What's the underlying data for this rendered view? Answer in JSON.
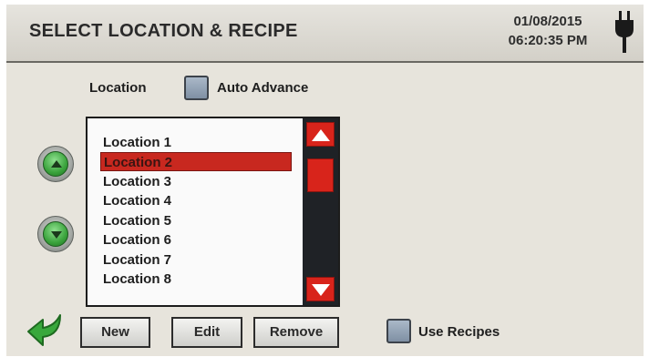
{
  "header": {
    "title": "SELECT LOCATION & RECIPE",
    "date": "01/08/2015",
    "time": "06:20:35 PM",
    "power_icon": "plug-icon"
  },
  "location_label": "Location",
  "auto_advance": {
    "label": "Auto Advance",
    "checked": false
  },
  "location_list": {
    "items": [
      "Location 1",
      "Location 2",
      "Location 3",
      "Location 4",
      "Location 5",
      "Location 6",
      "Location 7",
      "Location 8"
    ],
    "selected_index": 1
  },
  "nav": {
    "up_icon": "up-arrow-icon",
    "down_icon": "down-arrow-icon",
    "back_icon": "back-arrow-icon"
  },
  "buttons": {
    "new": "New",
    "edit": "Edit",
    "remove": "Remove"
  },
  "use_recipes": {
    "label": "Use Recipes",
    "checked": false
  },
  "colors": {
    "accent_red": "#d8241b",
    "selection_red": "#c8281f",
    "nav_green": "#3aa33c",
    "panel_bg": "#e7e4dc"
  }
}
